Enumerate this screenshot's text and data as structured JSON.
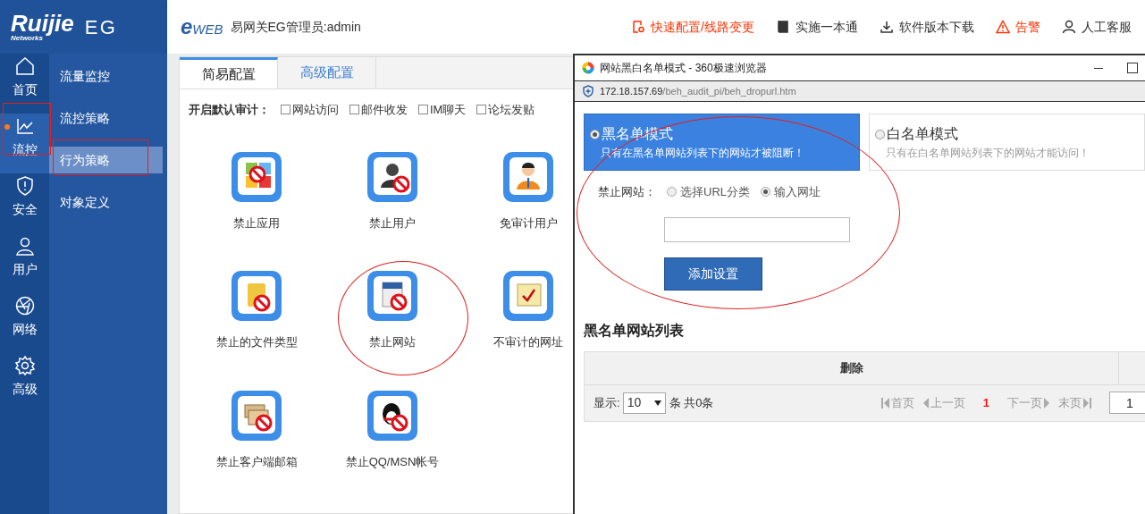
{
  "logo": {
    "brand": "Ruijie",
    "sub": "Networks",
    "product": "EG"
  },
  "header": {
    "brand": "eWEB",
    "title": "易网关EG管理员:admin",
    "links": [
      {
        "label": "快速配置/线路变更",
        "kind": "quick",
        "color": "#ff3300"
      },
      {
        "label": "实施一本通",
        "kind": "book",
        "color": "#333333"
      },
      {
        "label": "软件版本下载",
        "kind": "download",
        "color": "#333333"
      },
      {
        "label": "告警",
        "kind": "alert",
        "color": "#ff3300"
      },
      {
        "label": "人工客服",
        "kind": "support",
        "color": "#333333"
      }
    ]
  },
  "nav": [
    {
      "label": "首页",
      "kind": "home",
      "selected": false
    },
    {
      "label": "流控",
      "kind": "chart",
      "selected": true
    },
    {
      "label": "安全",
      "kind": "shield",
      "selected": false
    },
    {
      "label": "用户",
      "kind": "user",
      "selected": false
    },
    {
      "label": "网络",
      "kind": "network",
      "selected": false
    },
    {
      "label": "高级",
      "kind": "gear",
      "selected": false
    }
  ],
  "submenu": [
    {
      "label": "流量监控",
      "selected": false
    },
    {
      "label": "流控策略",
      "selected": false
    },
    {
      "label": "行为策略",
      "selected": true
    },
    {
      "label": "对象定义",
      "selected": false
    }
  ],
  "tabs": [
    {
      "label": "简易配置",
      "selected": true
    },
    {
      "label": "高级配置",
      "selected": false
    }
  ],
  "audit": {
    "label": "开启默认审计：",
    "options": [
      {
        "label": "网站访问",
        "checked": false
      },
      {
        "label": "邮件收发",
        "checked": false
      },
      {
        "label": "IM聊天",
        "checked": false
      },
      {
        "label": "论坛发贴",
        "checked": false
      }
    ]
  },
  "tiles": [
    {
      "label": "禁止应用",
      "kind": "apps"
    },
    {
      "label": "禁止用户",
      "kind": "user"
    },
    {
      "label": "免审计用户",
      "kind": "exempt"
    },
    {
      "label": "禁止的文件类型",
      "kind": "file"
    },
    {
      "label": "禁止网站",
      "kind": "web"
    },
    {
      "label": "不审计的网址",
      "kind": "url"
    },
    {
      "label": "禁止客户端邮箱",
      "kind": "mail"
    },
    {
      "label": "禁止QQ/MSN帐号",
      "kind": "qq"
    }
  ],
  "popup": {
    "title": "网站黑白名单模式 - 360极速浏览器",
    "address_host": "172.18.157.69",
    "address_path": "/beh_audit_pi/beh_dropurl.htm",
    "modes": [
      {
        "title": "黑名单模式",
        "desc": "只有在黑名单网站列表下的网站才被阻断！",
        "selected": true
      },
      {
        "title": "白名单模式",
        "desc": "只有在白名单网站列表下的网站才能访问！",
        "selected": false
      }
    ],
    "block_label": "禁止网站：",
    "block_options": [
      {
        "label": "选择URL分类",
        "selected": false
      },
      {
        "label": "输入网址",
        "selected": true
      }
    ],
    "add_button": "添加设置",
    "list_title": "黑名单网站列表",
    "columns": [
      "删除"
    ],
    "pager": {
      "show_label": "显示:",
      "page_size": "10",
      "count": "条 共0条",
      "first": "首页",
      "prev": "上一页",
      "current": "1",
      "next": "下一页",
      "last": "末页",
      "page_input": "1"
    }
  }
}
